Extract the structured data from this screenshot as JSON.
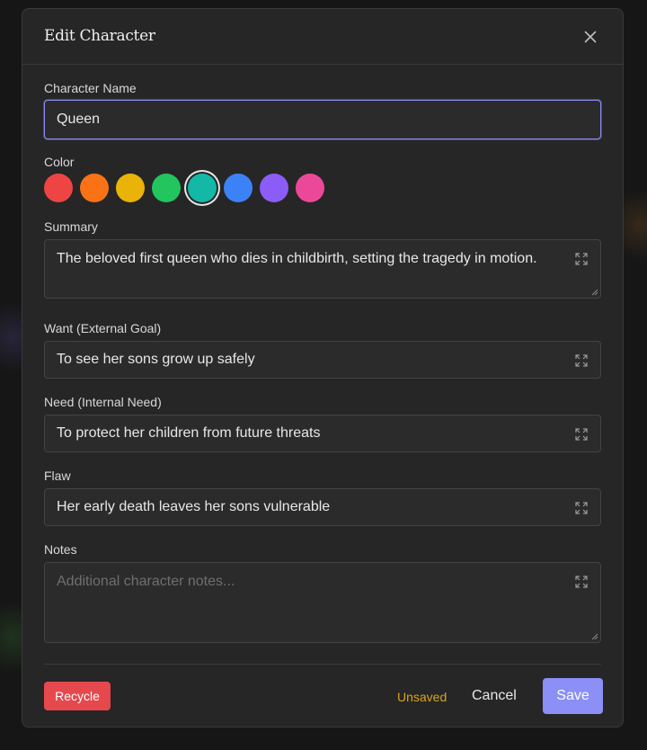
{
  "dialog": {
    "title": "Edit Character"
  },
  "fields": {
    "name_label": "Character Name",
    "name_value": "Queen",
    "color_label": "Color",
    "summary_label": "Summary",
    "summary_value": "The beloved first queen who dies in childbirth, setting the tragedy in motion.",
    "want_label": "Want (External Goal)",
    "want_value": "To see her sons grow up safely",
    "need_label": "Need (Internal Need)",
    "need_value": "To protect her children from future threats",
    "flaw_label": "Flaw",
    "flaw_value": "Her early death leaves her sons vulnerable",
    "notes_label": "Notes",
    "notes_placeholder": "Additional character notes..."
  },
  "colors": {
    "options": [
      "#ef4444",
      "#f97316",
      "#eab308",
      "#22c55e",
      "#14b8a6",
      "#3b82f6",
      "#8b5cf6",
      "#ec4899"
    ],
    "selected": "#14b8a6",
    "accent": "#8b8ff6"
  },
  "footer": {
    "recycle_label": "Recycle",
    "status": "Unsaved",
    "cancel_label": "Cancel",
    "save_label": "Save"
  },
  "icons": {
    "close": "close-icon",
    "expand": "expand-icon"
  }
}
